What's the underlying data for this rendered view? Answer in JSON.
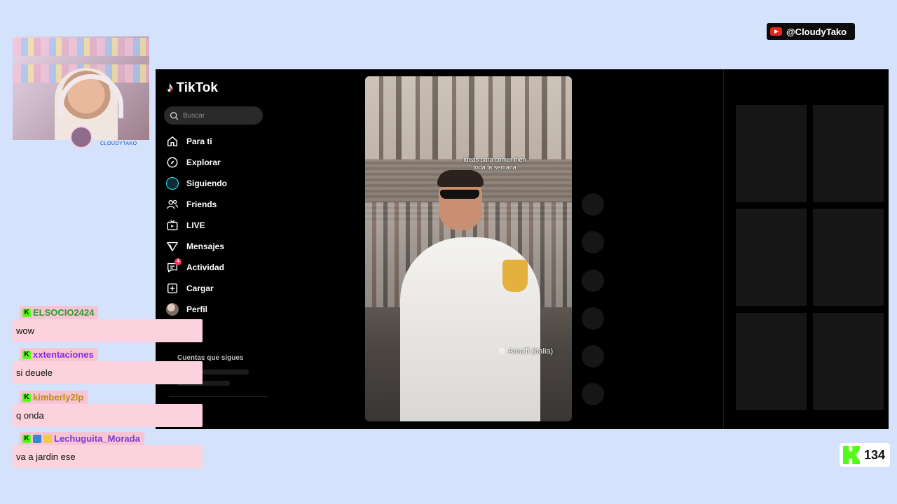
{
  "stream": {
    "webcam_caption": "CLOUDYTAKO",
    "yt_handle": "@CloudyTako",
    "viewer_count": "134"
  },
  "app": {
    "name": "TikTok",
    "search_placeholder": "Buscar",
    "nav": [
      {
        "label": "Para ti",
        "icon": "home-icon"
      },
      {
        "label": "Explorar",
        "icon": "compass-icon"
      },
      {
        "label": "Siguiendo",
        "icon": "following-avatar-icon"
      },
      {
        "label": "Friends",
        "icon": "friends-icon"
      },
      {
        "label": "LIVE",
        "icon": "live-tv-icon"
      },
      {
        "label": "Mensajes",
        "icon": "paper-plane-icon"
      },
      {
        "label": "Actividad",
        "icon": "inbox-icon",
        "badge": "4"
      },
      {
        "label": "Cargar",
        "icon": "upload-plus-icon"
      },
      {
        "label": "Perfil",
        "icon": "profile-avatar-icon"
      }
    ],
    "following_title": "Cuentas que sigues",
    "video": {
      "overlay_text": "ideas para comer bien toda la semana",
      "location": "Amalfi (Italia)"
    }
  },
  "chat": [
    {
      "user": "ELSOCIO2424",
      "user_color": "#2e9c2e",
      "message": "wow",
      "badges": [
        "kick"
      ]
    },
    {
      "user": "xxtentaciones",
      "user_color": "#8a2be2",
      "message": "si deuele",
      "badges": [
        "kick"
      ]
    },
    {
      "user": "kimberly2lp",
      "user_color": "#c0890b",
      "message": "q onda",
      "badges": [
        "kick"
      ]
    },
    {
      "user": "Lechuguita_Morada",
      "user_color": "#7a3bd0",
      "message": "va a jardin ese",
      "badges": [
        "kick",
        "blue",
        "gold"
      ]
    }
  ],
  "colors": {
    "page_bg": "#d4e2fb",
    "tiktok_bg": "#000000",
    "kick_green": "#53fc18",
    "chat_bubble": "#fbd2dd",
    "tiktok_red": "#fe2c55"
  }
}
